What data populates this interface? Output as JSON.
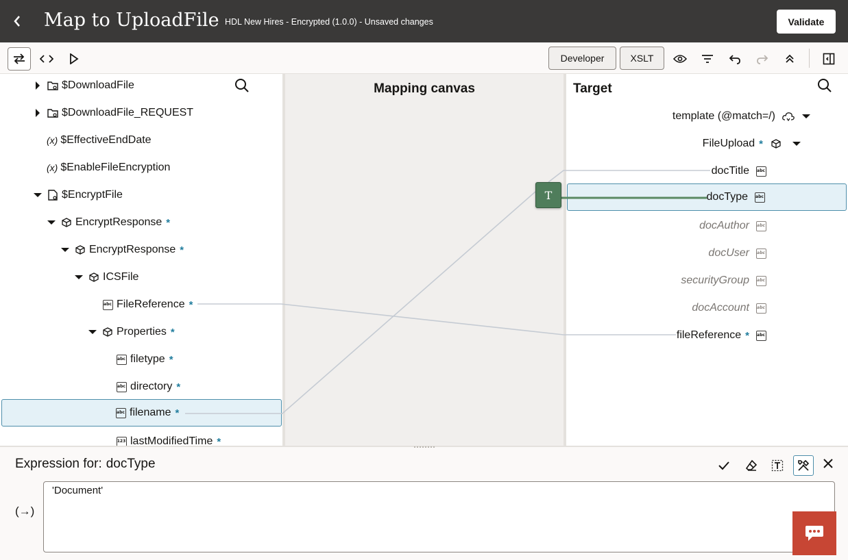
{
  "header": {
    "title": "Map to UploadFile",
    "subtitle": "HDL New Hires - Encrypted (1.0.0) - Unsaved changes",
    "validate_label": "Validate"
  },
  "toolbar": {
    "developer_label": "Developer",
    "xslt_label": "XSLT"
  },
  "source": {
    "items": [
      {
        "label": "$DownloadFile",
        "required": false
      },
      {
        "label": "$DownloadFile_REQUEST",
        "required": false
      },
      {
        "label": "$EffectiveEndDate",
        "required": false
      },
      {
        "label": "$EnableFileEncryption",
        "required": false
      },
      {
        "label": "$EncryptFile",
        "required": false
      },
      {
        "label": "EncryptResponse",
        "required": true
      },
      {
        "label": "EncryptResponse",
        "required": true
      },
      {
        "label": "ICSFile",
        "required": false
      },
      {
        "label": "FileReference",
        "required": true
      },
      {
        "label": "Properties",
        "required": true
      },
      {
        "label": "filetype",
        "required": true
      },
      {
        "label": "directory",
        "required": true
      },
      {
        "label": "filename",
        "required": true
      },
      {
        "label": "lastModifiedTime",
        "required": true
      }
    ],
    "required_mark": "*",
    "var_glyph": "(x)"
  },
  "canvas": {
    "title": "Mapping canvas",
    "function_glyph": "T"
  },
  "target": {
    "title": "Target",
    "items": [
      {
        "label": "template (@match=/)"
      },
      {
        "label": "FileUpload"
      },
      {
        "label": "docTitle"
      },
      {
        "label": "docType"
      },
      {
        "label": "docAuthor"
      },
      {
        "label": "docUser"
      },
      {
        "label": "securityGroup"
      },
      {
        "label": "docAccount"
      },
      {
        "label": "fileReference"
      }
    ],
    "required_mark": "*"
  },
  "expression": {
    "label": "Expression for:",
    "target": "docType",
    "value": "'Document'",
    "fx_glyph": "(→)"
  },
  "colors": {
    "header_bg": "#3a3938",
    "selected_bg": "#e4f1f7",
    "function_node": "#4f7d5b",
    "required": "#227e9e",
    "chat": "#c74634"
  }
}
